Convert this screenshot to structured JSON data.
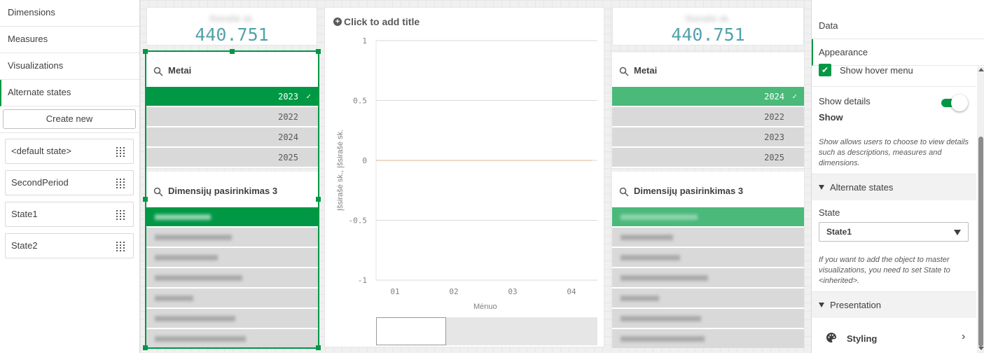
{
  "left_panel": {
    "nav": [
      "Dimensions",
      "Measures",
      "Visualizations",
      "Alternate states"
    ],
    "create_label": "Create new",
    "states": [
      "<default state>",
      "SecondPeriod",
      "State1",
      "State2"
    ]
  },
  "kpi_left": {
    "value": "440.751"
  },
  "kpi_right": {
    "value": "440.751"
  },
  "filter_left": {
    "title": "Metai",
    "items": [
      {
        "label": "2023",
        "state": "selected"
      },
      {
        "label": "2022",
        "state": "alternative"
      },
      {
        "label": "2024",
        "state": "alternative"
      },
      {
        "label": "2025",
        "state": "alternative"
      }
    ]
  },
  "filter_right": {
    "title": "Metai",
    "items": [
      {
        "label": "2024",
        "state": "selected"
      },
      {
        "label": "2022",
        "state": "alternative"
      },
      {
        "label": "2023",
        "state": "alternative"
      },
      {
        "label": "2025",
        "state": "alternative"
      }
    ]
  },
  "dim_left": {
    "title": "Dimensijų pasirinkimas 3"
  },
  "dim_right": {
    "title": "Dimensijų pasirinkimas 3"
  },
  "chart": {
    "title_prompt": "Click to add title",
    "ylabel": "Įšsirašė sk., Įšsirašė sk.",
    "xlabel": "Mėnuo"
  },
  "chart_data": {
    "type": "line",
    "categories": [
      "01",
      "02",
      "03",
      "04"
    ],
    "yticks": [
      "1",
      "0.5",
      "0",
      "-0.5",
      "-1"
    ],
    "ylim": [
      -1,
      1
    ],
    "series": [
      {
        "values": [
          0,
          0,
          0,
          0
        ],
        "color": "#e0b090"
      }
    ],
    "xlabel": "Mėnuo",
    "ylabel": "Įšsirašė sk., Įšsirašė sk.",
    "grid": true
  },
  "right_panel": {
    "tab_data": "Data",
    "tab_appearance": "Appearance",
    "hover_menu": "Show hover menu",
    "show_details_label": "Show details",
    "show_details_value": "Show",
    "details_help": "Show allows users to choose to view details such as descriptions, measures and dimensions.",
    "alt_states_section": "Alternate states",
    "state_label": "State",
    "state_value": "State1",
    "state_help": "If you want to add the object to master visualizations, you need to set State to <inherited>.",
    "presentation_section": "Presentation",
    "styling_label": "Styling"
  },
  "colors": {
    "accent": "#009845",
    "selected_alt": "#4ab97a",
    "kpi": "#52a2aa",
    "alternative": "#d9d9d9"
  }
}
